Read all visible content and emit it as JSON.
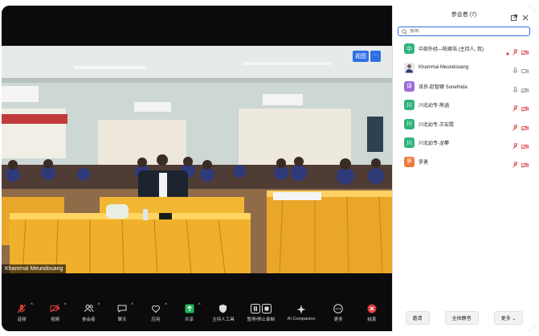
{
  "video": {
    "speaker_name": "Khammai Meundouang",
    "view_button": "视图"
  },
  "toolbar": {
    "items": [
      {
        "label": "音频",
        "icon": "microphone-muted-icon"
      },
      {
        "label": "视频",
        "icon": "camera-off-icon"
      },
      {
        "label": "参会者",
        "icon": "participants-icon"
      },
      {
        "label": "聊天",
        "icon": "chat-icon"
      },
      {
        "label": "应用",
        "icon": "apps-icon"
      },
      {
        "label": "共享",
        "icon": "share-screen-icon"
      },
      {
        "label": "主持人工具",
        "icon": "shield-icon"
      },
      {
        "label": "暂停/停止录制",
        "icon": "pause-stop-recording-icon"
      },
      {
        "label": "AI Companion",
        "icon": "sparkle-icon"
      },
      {
        "label": "更多",
        "icon": "more-icon"
      },
      {
        "label": "结束",
        "icon": "end-meeting-icon"
      }
    ]
  },
  "panel": {
    "title": "参会者 (7)",
    "search_placeholder": "搜索",
    "participants": [
      {
        "avatar": "中",
        "color": "#2fb37a",
        "name": "中部外经—陈卿浩 (主持人, 我)",
        "recording": true,
        "audio": "muted",
        "video": "off"
      },
      {
        "avatar": "",
        "color": "#ffffff",
        "name": "Khammai Meundouang",
        "photo": true,
        "audio": "on",
        "video": "on"
      },
      {
        "avatar": "译",
        "color": "#9b6cd9",
        "name": "译员-赵智娜 Sonethida",
        "audio": "on",
        "video": "off"
      },
      {
        "avatar": "川",
        "color": "#2fb37a",
        "name": "川北幼专-熊涵",
        "audio": "muted",
        "video": "off"
      },
      {
        "avatar": "川",
        "color": "#2fb37a",
        "name": "川北幼专-王宏霞",
        "audio": "muted",
        "video": "off"
      },
      {
        "avatar": "川",
        "color": "#2fb37a",
        "name": "川北幼专-龙攀",
        "audio": "muted",
        "video": "off"
      },
      {
        "avatar": "罗",
        "color": "#f07a3a",
        "name": "罗勇",
        "audio": "muted",
        "video": "off"
      }
    ],
    "footer": {
      "invite": "邀请",
      "mute_all": "全体静音",
      "more": "更多"
    }
  }
}
